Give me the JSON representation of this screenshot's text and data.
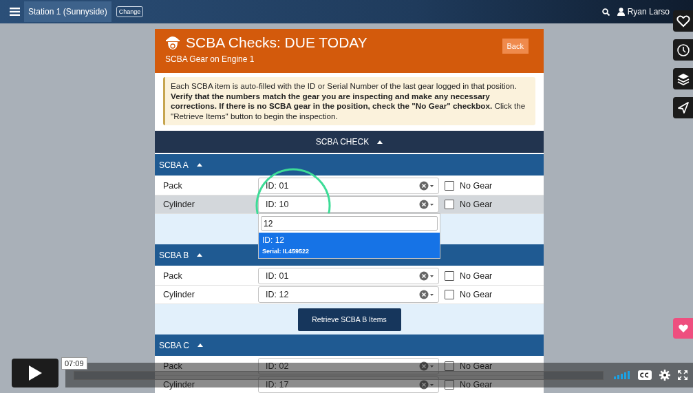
{
  "top_bar": {
    "station": "Station 1 (Sunnyside)",
    "change_button": "Change",
    "user": "Ryan Larso"
  },
  "header": {
    "title": "SCBA Checks: DUE TODAY",
    "subtitle": "SCBA Gear on Engine 1",
    "back_button": "Back"
  },
  "notice": "Each SCBA item is auto-filled with the ID or Serial Number of the last gear logged in that position. **Verify that the numbers match the gear you are inspecting and make any necessary corrections. If there is no SCBA gear in the position, check the \"No Gear\" checkbox.** Click the \"Retrieve Items\" button to begin the inspection.",
  "section": {
    "title": "SCBA CHECK",
    "expanded": true
  },
  "groups": [
    {
      "title": "SCBA A",
      "expanded": true,
      "items": [
        {
          "label": "Pack",
          "value": "ID: 01",
          "no_gear_label": "No Gear",
          "no_gear": false,
          "selected": false
        },
        {
          "label": "Cylinder",
          "value": "ID: 10",
          "no_gear_label": "No Gear",
          "no_gear": false,
          "selected": true,
          "dropdown": {
            "search": "12",
            "options": [
              {
                "id": "ID: 12",
                "serial": "Serial: IL459522",
                "selected": true
              }
            ]
          }
        }
      ]
    },
    {
      "title": "SCBA B",
      "expanded": true,
      "items": [
        {
          "label": "Pack",
          "value": "ID: 01",
          "no_gear_label": "No Gear",
          "no_gear": false,
          "selected": false
        },
        {
          "label": "Cylinder",
          "value": "ID: 12",
          "no_gear_label": "No Gear",
          "no_gear": false,
          "selected": false
        }
      ],
      "button": "Retrieve SCBA B Items"
    },
    {
      "title": "SCBA C",
      "expanded": true,
      "items": [
        {
          "label": "Pack",
          "value": "ID: 02",
          "no_gear_label": "No Gear",
          "no_gear": false,
          "selected": false
        },
        {
          "label": "Cylinder",
          "value": "ID: 17",
          "no_gear_label": "No Gear",
          "no_gear": false,
          "selected": false
        }
      ]
    }
  ],
  "player": {
    "time": "07:09"
  }
}
